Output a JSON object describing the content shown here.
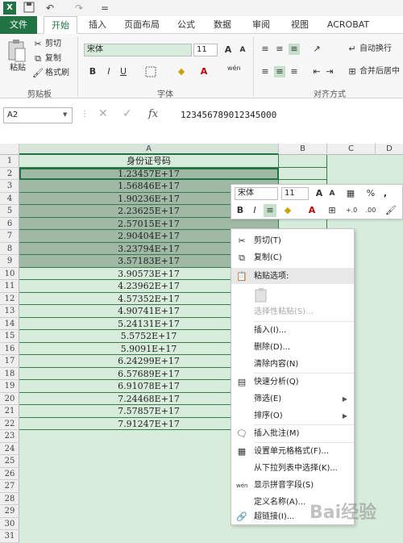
{
  "quick_access": {
    "undo": "↶",
    "redo": "↷",
    "more": "="
  },
  "tabs": [
    {
      "label": "文件"
    },
    {
      "label": "开始"
    },
    {
      "label": "插入"
    },
    {
      "label": "页面布局"
    },
    {
      "label": "公式"
    },
    {
      "label": "数据"
    },
    {
      "label": "审阅"
    },
    {
      "label": "视图"
    },
    {
      "label": "ACROBAT"
    }
  ],
  "ribbon": {
    "clipboard": {
      "paste": "粘贴",
      "cut": "剪切",
      "copy": "复制",
      "format_painter": "格式刷",
      "label": "剪贴板"
    },
    "font": {
      "name": "宋体",
      "size": "11",
      "bold": "B",
      "italic": "I",
      "underline": "U",
      "label": "字体",
      "grow": "A",
      "shrink": "A",
      "wen": "wén"
    },
    "alignment": {
      "wrap": "自动换行",
      "merge": "合并后居中",
      "label": "对齐方式"
    }
  },
  "formula_bar": {
    "name_box": "A2",
    "fx": "fx",
    "value": "123456789012345000"
  },
  "columns": [
    "A",
    "B",
    "C",
    "D"
  ],
  "rows": [
    "1",
    "2",
    "3",
    "4",
    "5",
    "6",
    "7",
    "8",
    "9",
    "10",
    "11",
    "12",
    "13",
    "14",
    "15",
    "16",
    "17",
    "18",
    "19",
    "20",
    "21",
    "22",
    "23",
    "24",
    "25",
    "26",
    "27",
    "28",
    "29",
    "30",
    "31"
  ],
  "cells": [
    "身份证号码",
    "1.23457E+17",
    "1.56846E+17",
    "1.90236E+17",
    "2.23625E+17",
    "2.57015E+17",
    "2.90404E+17",
    "3.23794E+17",
    "3.57183E+17",
    "3.90573E+17",
    "4.23962E+17",
    "4.57352E+17",
    "4.90741E+17",
    "5.24131E+17",
    "5.5752E+17",
    "5.9091E+17",
    "6.24299E+17",
    "6.57689E+17",
    "6.91078E+17",
    "7.24468E+17",
    "7.57857E+17",
    "7.91247E+17"
  ],
  "mini_toolbar": {
    "font": "宋体",
    "size": "11",
    "percent": "%",
    "comma": ",",
    "bold": "B",
    "italic": "I",
    "inc": "+.0",
    "dec": ".00"
  },
  "context_menu": {
    "cut": "剪切(T)",
    "copy": "复制(C)",
    "paste_options": "粘贴选项:",
    "paste_special": "选择性粘贴(S)...",
    "insert": "插入(I)...",
    "delete": "删除(D)...",
    "clear": "清除内容(N)",
    "quick_analysis": "快速分析(Q)",
    "filter": "筛选(E)",
    "sort": "排序(O)",
    "insert_comment": "插入批注(M)",
    "format_cells": "设置单元格格式(F)...",
    "pick_list": "从下拉列表中选择(K)...",
    "phonetic": "显示拼音字段(S)",
    "define_name": "定义名称(A)...",
    "hyperlink": "超链接(I)..."
  },
  "watermark": "Bai经验",
  "colors": {
    "accent": "#217346",
    "selection": "#9fb9a5",
    "grid_bg": "#d8ecdc"
  }
}
